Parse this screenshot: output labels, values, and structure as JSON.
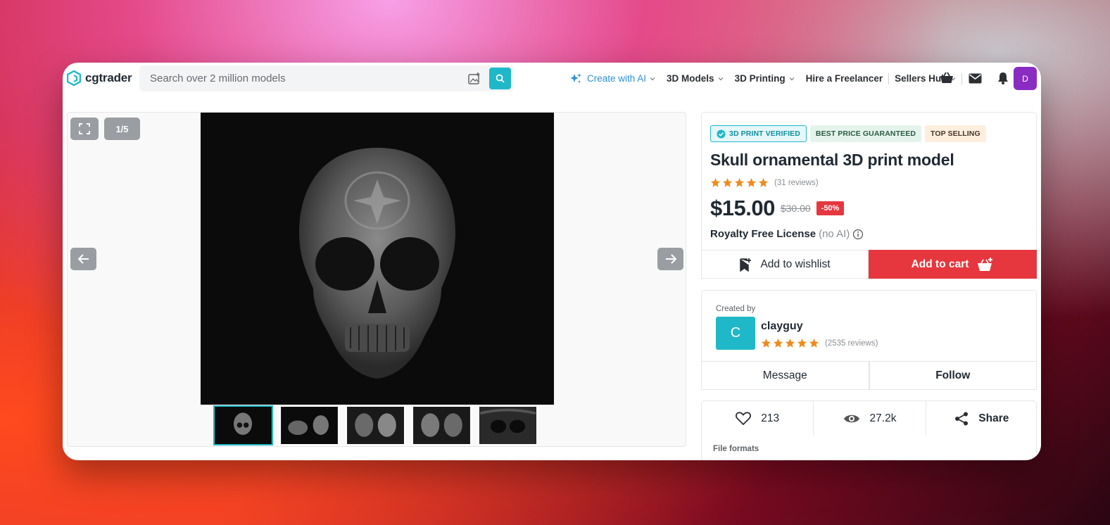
{
  "header": {
    "logo_text": "cgtrader",
    "search_placeholder": "Search over 2 million models",
    "nav": [
      {
        "label": "Create with AI",
        "icon": "sparkle-icon"
      },
      {
        "label": "3D Models"
      },
      {
        "label": "3D Printing"
      },
      {
        "label": "Hire a Freelancer"
      },
      {
        "label": "Sellers Hub"
      }
    ],
    "avatar_initial": "D"
  },
  "gallery": {
    "counter": "1/5",
    "thumb_count": 5
  },
  "product": {
    "badges": [
      "3D PRINT VERIFIED",
      "BEST PRICE GUARANTEED",
      "TOP SELLING"
    ],
    "title": "Skull ornamental 3D print model",
    "rating_stars": 5,
    "reviews": "(31 reviews)",
    "price": "$15.00",
    "old_price": "$30.00",
    "discount": "-50%",
    "license": "Royalty Free License",
    "license_note": "(no AI)",
    "wishlist_label": "Add to wishlist",
    "cart_label": "Add to cart"
  },
  "creator": {
    "created_by_label": "Created by",
    "initial": "C",
    "name": "clayguy",
    "rating_stars": 5,
    "reviews": "(2535 reviews)",
    "message_label": "Message",
    "follow_label": "Follow"
  },
  "stats": {
    "likes": "213",
    "views": "27.2k",
    "share_label": "Share",
    "file_formats_label": "File formats"
  },
  "colors": {
    "accent": "#1fb8c8",
    "cart": "#e5373d",
    "star": "#f08a1c",
    "avatar": "#8a2bc2"
  }
}
